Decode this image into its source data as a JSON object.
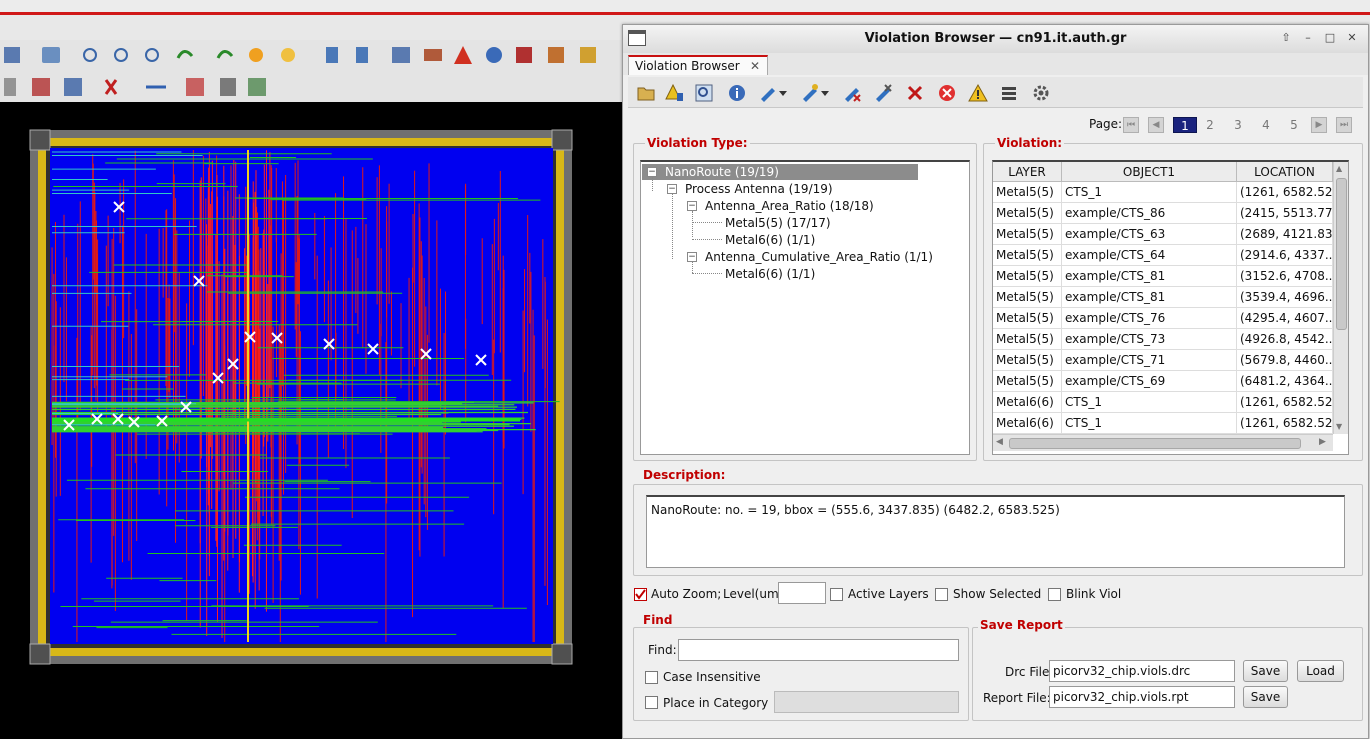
{
  "dialog": {
    "title": "Violation Browser — cn91.it.auth.gr",
    "tab_label": "Violation Browser",
    "tab_close": "✕"
  },
  "pager": {
    "label": "Page:",
    "pages": [
      "1",
      "2",
      "3",
      "4",
      "5"
    ],
    "current": "1"
  },
  "violation_type": {
    "title": "Violation Type:",
    "tree": [
      {
        "label": "NanoRoute (19/19)",
        "selected": true
      },
      {
        "label": "Process Antenna (19/19)"
      },
      {
        "label": "Antenna_Area_Ratio (18/18)"
      },
      {
        "label": "Metal5(5) (17/17)"
      },
      {
        "label": "Metal6(6) (1/1)"
      },
      {
        "label": "Antenna_Cumulative_Area_Ratio (1/1)"
      },
      {
        "label": "Metal6(6) (1/1)"
      }
    ]
  },
  "violation": {
    "title": "Violation:",
    "columns": [
      "LAYER",
      "OBJECT1",
      "LOCATION"
    ],
    "rows": [
      [
        "Metal5(5)",
        "CTS_1",
        "(1261, 6582.52..."
      ],
      [
        "Metal5(5)",
        "example/CTS_86",
        "(2415, 5513.77..."
      ],
      [
        "Metal5(5)",
        "example/CTS_63",
        "(2689, 4121.83..."
      ],
      [
        "Metal5(5)",
        "example/CTS_64",
        "(2914.6, 4337...."
      ],
      [
        "Metal5(5)",
        "example/CTS_81",
        "(3152.6, 4708...."
      ],
      [
        "Metal5(5)",
        "example/CTS_81",
        "(3539.4, 4696...."
      ],
      [
        "Metal5(5)",
        "example/CTS_76",
        "(4295.4, 4607...."
      ],
      [
        "Metal5(5)",
        "example/CTS_73",
        "(4926.8, 4542...."
      ],
      [
        "Metal5(5)",
        "example/CTS_71",
        "(5679.8, 4460...."
      ],
      [
        "Metal5(5)",
        "example/CTS_69",
        "(6481.2, 4364...."
      ],
      [
        "Metal6(6)",
        "CTS_1",
        "(1261, 6582.52..."
      ],
      [
        "Metal6(6)",
        "CTS_1",
        "(1261, 6582.52..."
      ]
    ]
  },
  "description": {
    "title": "Description:",
    "text": "NanoRoute: no. = 19, bbox = (555.6, 3437.835) (6482.2, 6583.525)"
  },
  "options": {
    "auto_zoom": "Auto Zoom;",
    "level_label": "Level(um)",
    "level_value": "",
    "active_layers": "Active Layers",
    "show_selected": "Show Selected",
    "blink_viol": "Blink Viol"
  },
  "find": {
    "title": "Find",
    "find_label": "Find:",
    "find_value": "",
    "case_insensitive": "Case Insensitive",
    "place_in_category": "Place in Category"
  },
  "save_report": {
    "title": "Save Report",
    "drc_label": "Drc File:",
    "drc_value": "picorv32_chip.viols.drc",
    "report_label": "Report File:",
    "report_value": "picorv32_chip.viols.rpt",
    "save": "Save",
    "load": "Load"
  },
  "colors": {
    "accent_red": "#c00000",
    "canvas_bg": "#000000",
    "core_blue": "#0000f0",
    "pad_yellow": "#e0c020"
  }
}
